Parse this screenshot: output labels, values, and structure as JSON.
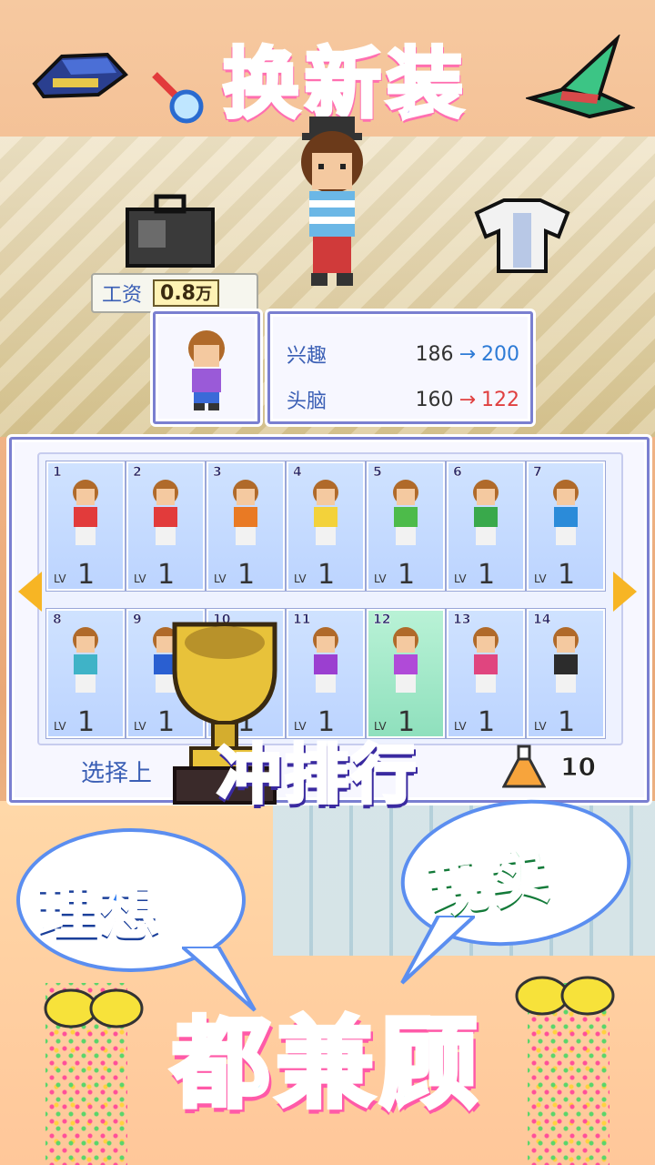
{
  "title": "换新装",
  "salary": {
    "label": "工资",
    "value": "0.8",
    "unit": "万"
  },
  "stats": [
    {
      "name": "兴趣",
      "old": "186",
      "arrow": "→",
      "new": "200",
      "trend": "up"
    },
    {
      "name": "头脑",
      "old": "160",
      "arrow": "→",
      "new": "122",
      "trend": "down"
    }
  ],
  "outfits": [
    {
      "num": "1",
      "lv_label": "LV",
      "lv": "1",
      "shirt": "#e23b3b"
    },
    {
      "num": "2",
      "lv_label": "LV",
      "lv": "1",
      "shirt": "#e23b3b"
    },
    {
      "num": "3",
      "lv_label": "LV",
      "lv": "1",
      "shirt": "#e97a24"
    },
    {
      "num": "4",
      "lv_label": "LV",
      "lv": "1",
      "shirt": "#f3d23a"
    },
    {
      "num": "5",
      "lv_label": "LV",
      "lv": "1",
      "shirt": "#4dbb4a"
    },
    {
      "num": "6",
      "lv_label": "LV",
      "lv": "1",
      "shirt": "#39a94b"
    },
    {
      "num": "7",
      "lv_label": "LV",
      "lv": "1",
      "shirt": "#2b8bd9"
    },
    {
      "num": "8",
      "lv_label": "LV",
      "lv": "1",
      "shirt": "#3fb3c7"
    },
    {
      "num": "9",
      "lv_label": "LV",
      "lv": "1",
      "shirt": "#2a5fd1"
    },
    {
      "num": "10",
      "lv_label": "LV",
      "lv": "1",
      "shirt": "#7a4ad0"
    },
    {
      "num": "11",
      "lv_label": "LV",
      "lv": "1",
      "shirt": "#9b3fd0"
    },
    {
      "num": "12",
      "lv_label": "LV",
      "lv": "1",
      "shirt": "#b04ad8",
      "selected": true
    },
    {
      "num": "13",
      "lv_label": "LV",
      "lv": "1",
      "shirt": "#e0457f"
    },
    {
      "num": "14",
      "lv_label": "LV",
      "lv": "1",
      "shirt": "#2c2c2c"
    }
  ],
  "select_text": "选择上",
  "flask_count": "10",
  "rank_text": "冲排行",
  "bubble_left": "理想",
  "bubble_right": "现实",
  "bottom_text": "都兼顾",
  "colors": {
    "panel_border": "#7a7fd0",
    "accent_blue": "#3b5fb5",
    "up": "#2e7bd6",
    "down": "#e04040",
    "nav": "#f7b524"
  },
  "icons": [
    "blue-cap-icon",
    "green-wizard-hat-icon",
    "magnifier-icon",
    "dark-bag-icon",
    "white-shirt-icon",
    "flask-icon",
    "trophy-icon",
    "left-arrow-icon",
    "right-arrow-icon",
    "pointer-hand-icon"
  ]
}
